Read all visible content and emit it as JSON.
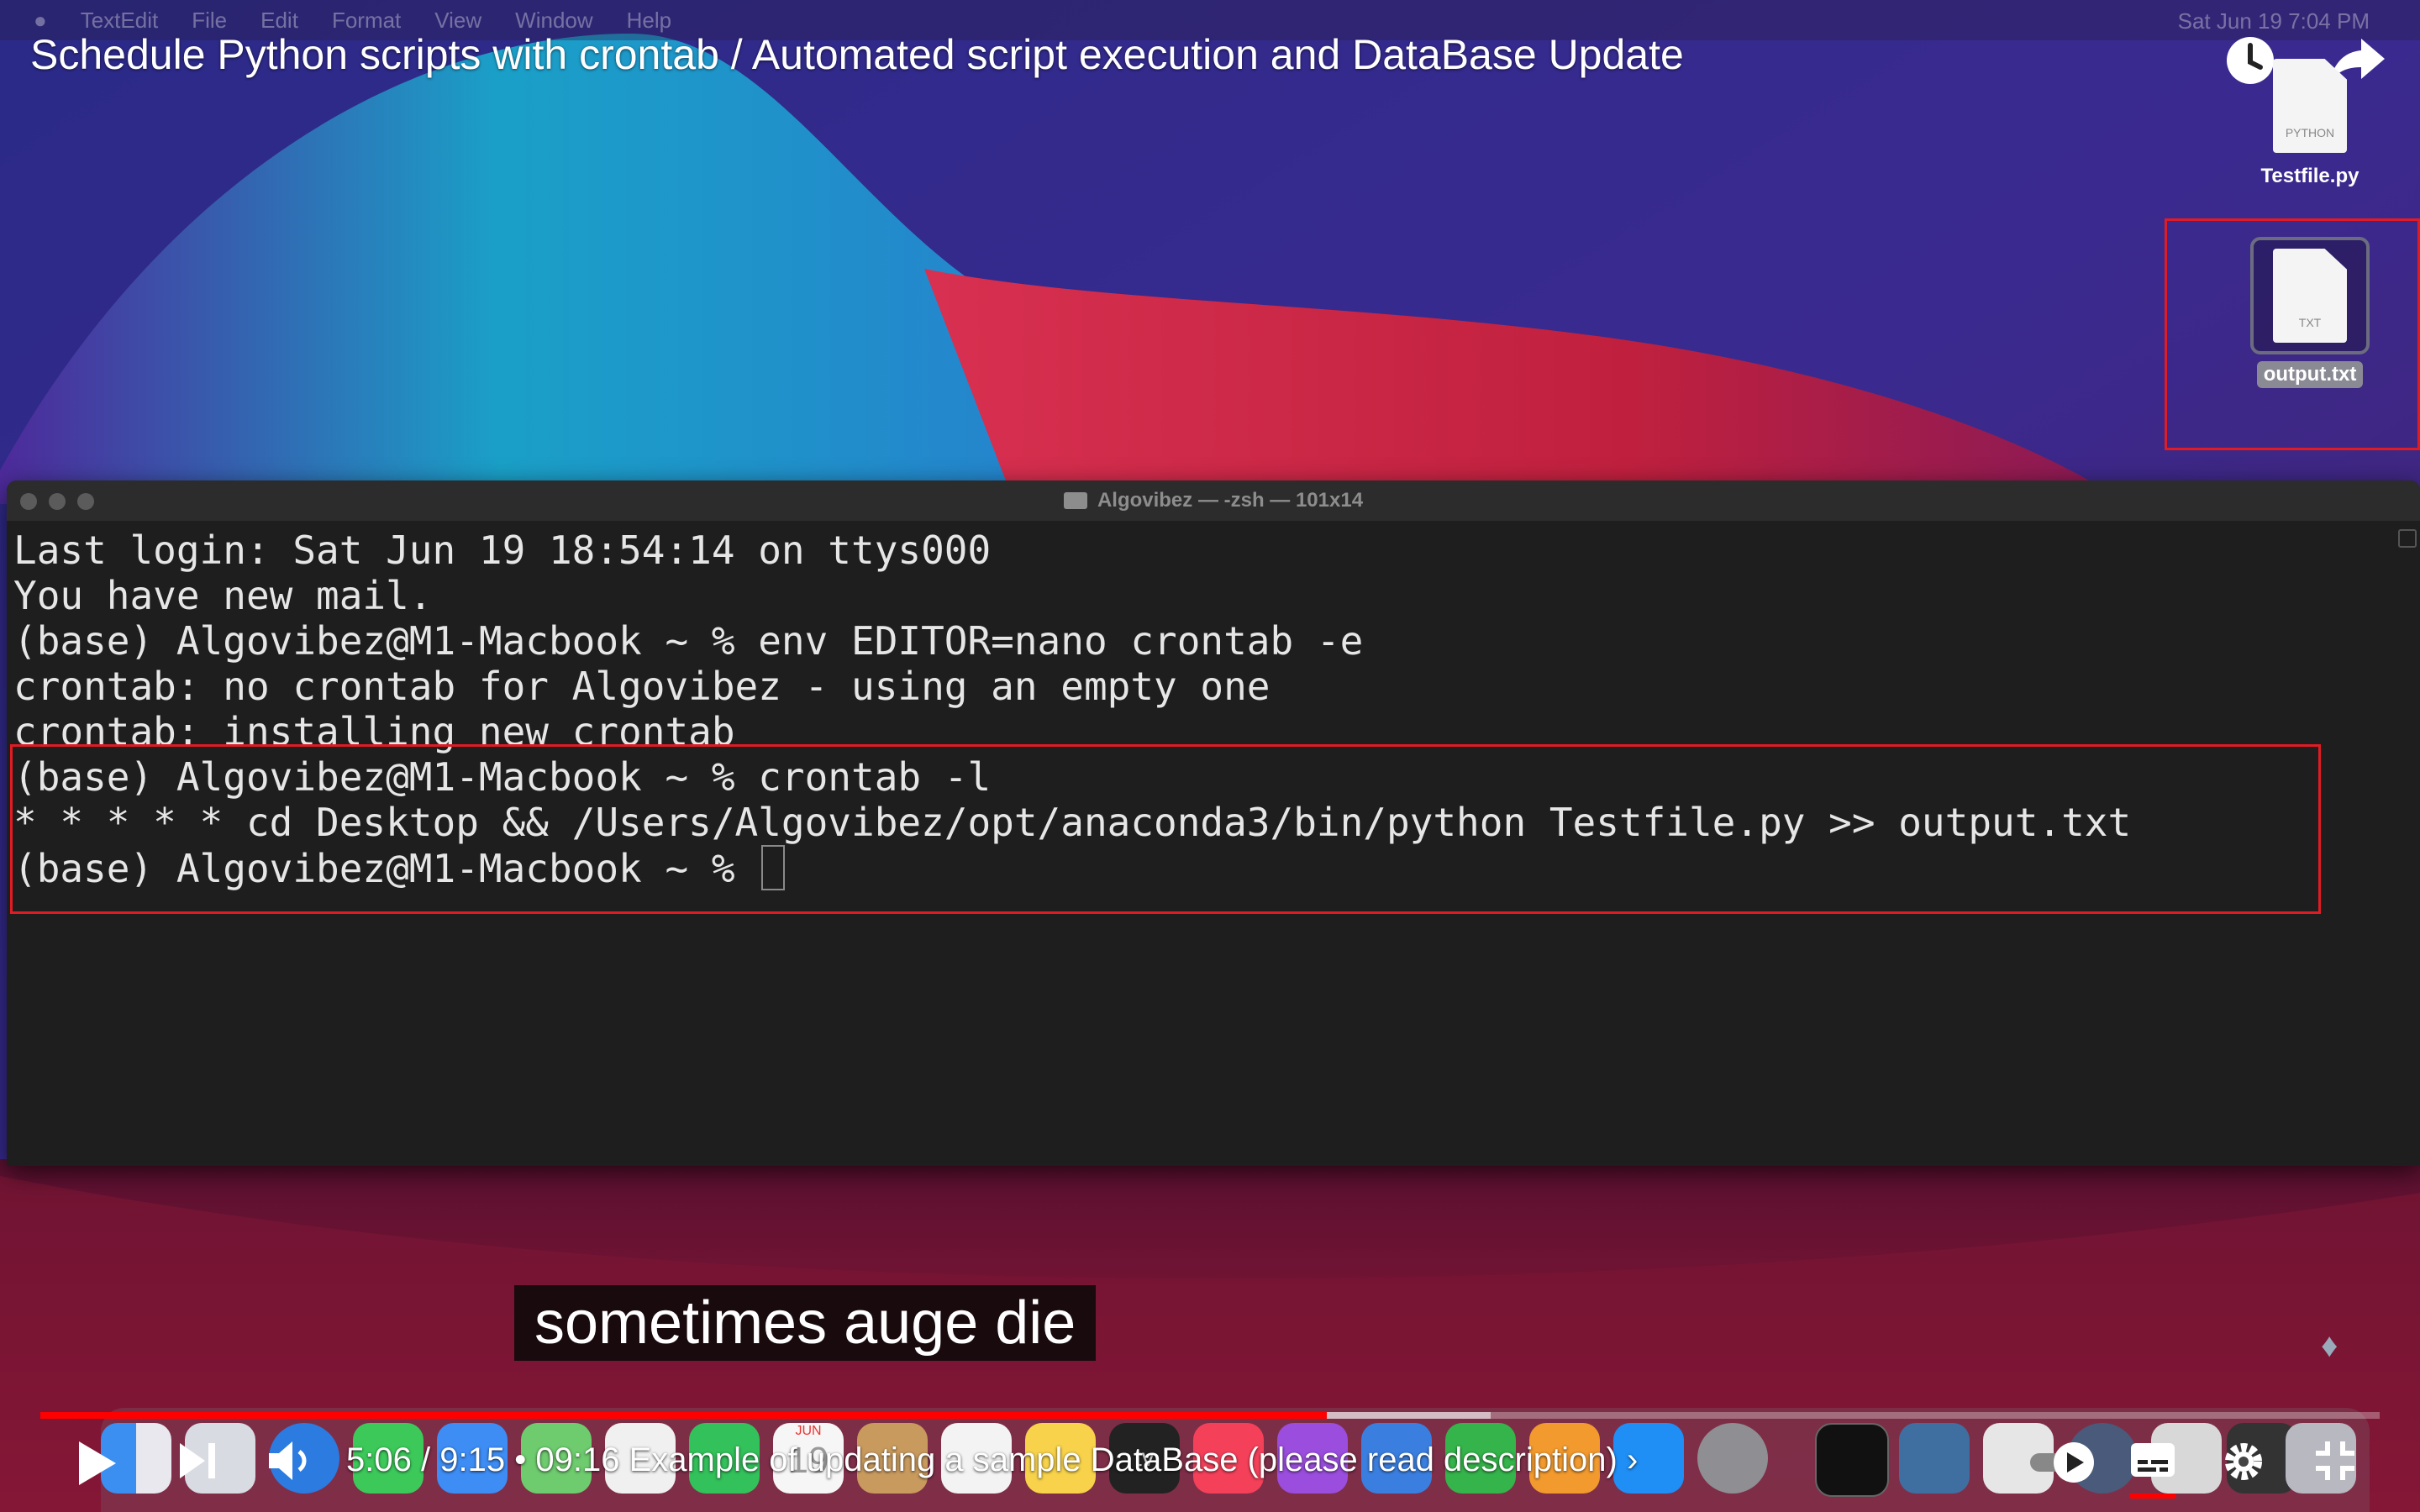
{
  "video": {
    "title": "Schedule Python scripts with crontab / Automated script execution and DataBase Update",
    "caption": "sometimes auge die",
    "current_time": "5:06",
    "duration": "9:15",
    "time_separator": "/",
    "chapter_separator": "•",
    "chapter": "09:16 Example of updating a sample DataBase (please read description)",
    "chapter_arrow": "›",
    "progress_played": 0.55,
    "progress_loaded": 0.62
  },
  "menubar": {
    "items": [
      "TextEdit",
      "File",
      "Edit",
      "Format",
      "View",
      "Window",
      "Help"
    ],
    "clock": "Sat Jun 19  7:04 PM"
  },
  "desktop": {
    "icons": [
      {
        "label": "Testfile.py",
        "ext": "PYTHON"
      },
      {
        "label": "output.txt",
        "ext": "TXT"
      }
    ]
  },
  "terminal": {
    "title": "Algovibez — -zsh — 101x14",
    "lines": [
      "Last login: Sat Jun 19 18:54:14 on ttys000",
      "You have new mail.",
      "(base) Algovibez@M1-Macbook ~ % env EDITOR=nano crontab -e",
      "crontab: no crontab for Algovibez - using an empty one",
      "crontab: installing new crontab",
      "(base) Algovibez@M1-Macbook ~ % crontab -l",
      "* * * * * cd Desktop && /Users/Algovibez/opt/anaconda3/bin/python Testfile.py >> output.txt",
      "(base) Algovibez@M1-Macbook ~ % "
    ]
  },
  "dock": {
    "apps": [
      "finder",
      "launchpad",
      "safari",
      "messages",
      "mail",
      "maps",
      "photos",
      "facetime",
      "calendar",
      "contacts",
      "reminders",
      "notes",
      "tv",
      "music",
      "podcasts",
      "keynote",
      "numbers",
      "pages",
      "app-store",
      "system-preferences",
      "terminal",
      "mysql-workbench",
      "textedit",
      "quicktime",
      "preview",
      "screen",
      "trash"
    ],
    "calendar_month": "JUN",
    "calendar_day": "19",
    "tv_label": "tv"
  },
  "colors": {
    "highlight_red": "#e01b24",
    "progress_red": "#ff0000",
    "terminal_bg": "#1e1e1e"
  }
}
